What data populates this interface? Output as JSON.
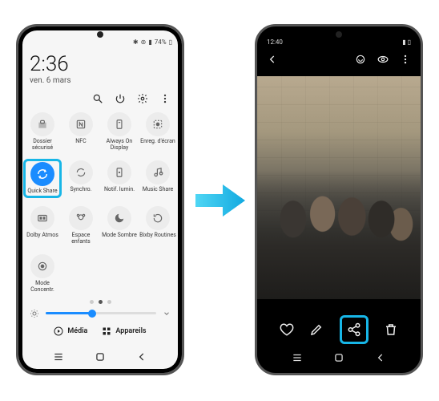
{
  "left": {
    "status": {
      "battery_pct": "74%"
    },
    "time": "2:36",
    "date": "ven. 6 mars",
    "tiles": [
      {
        "label": "Dossier sécurisé",
        "active": false
      },
      {
        "label": "NFC",
        "active": false
      },
      {
        "label": "Always On Display",
        "active": false
      },
      {
        "label": "Enreg. d'écran",
        "active": false
      },
      {
        "label": "Quick Share",
        "active": true,
        "highlight": true
      },
      {
        "label": "Synchro.",
        "active": false
      },
      {
        "label": "Notif. lumin.",
        "active": false
      },
      {
        "label": "Music Share",
        "active": false
      },
      {
        "label": "Dolby Atmos",
        "active": false
      },
      {
        "label": "Espace enfants",
        "active": false
      },
      {
        "label": "Mode Sombre",
        "active": false
      },
      {
        "label": "Bixby Routines",
        "active": false
      },
      {
        "label": "Mode Concentr.",
        "active": false
      }
    ],
    "pager": {
      "count": 3,
      "active": 1
    },
    "brightness_pct": 42,
    "buttons": {
      "media": "Média",
      "devices": "Appareils"
    }
  },
  "right": {
    "status": {
      "time": "12:40"
    },
    "highlight": "share"
  },
  "accent": "#17b6e7"
}
